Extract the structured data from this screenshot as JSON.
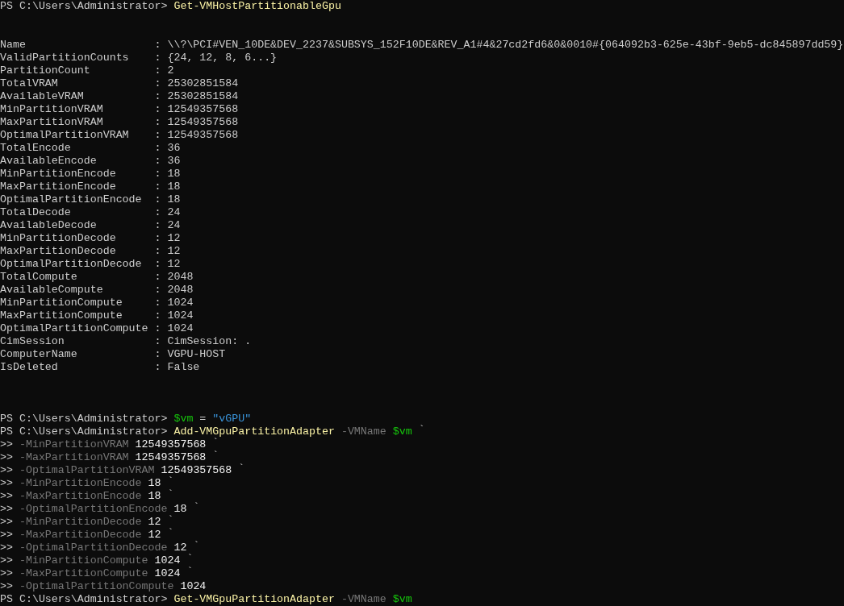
{
  "lines": [
    {
      "kind": "input",
      "segments": [
        {
          "kind": "prompt",
          "text": "PS C:\\Users\\Administrator>"
        },
        {
          "kind": "command",
          "text": "Get-VMHostPartitionableGpu"
        }
      ]
    },
    {
      "kind": "blank"
    },
    {
      "kind": "blank"
    },
    {
      "kind": "property",
      "name": "Name",
      "sep": ":",
      "value": "\\\\?\\PCI#VEN_10DE&DEV_2237&SUBSYS_152F10DE&REV_A1#4&27cd2fd6&0&0010#{064092b3-625e-43bf-9eb5-dc845897dd59}"
    },
    {
      "kind": "property",
      "name": "ValidPartitionCounts",
      "sep": ":",
      "value": "{24, 12, 8, 6...}"
    },
    {
      "kind": "property",
      "name": "PartitionCount",
      "sep": ":",
      "value": "2"
    },
    {
      "kind": "property",
      "name": "TotalVRAM",
      "sep": ":",
      "value": "25302851584"
    },
    {
      "kind": "property",
      "name": "AvailableVRAM",
      "sep": ":",
      "value": "25302851584"
    },
    {
      "kind": "property",
      "name": "MinPartitionVRAM",
      "sep": ":",
      "value": "12549357568"
    },
    {
      "kind": "property",
      "name": "MaxPartitionVRAM",
      "sep": ":",
      "value": "12549357568"
    },
    {
      "kind": "property",
      "name": "OptimalPartitionVRAM",
      "sep": ":",
      "value": "12549357568"
    },
    {
      "kind": "property",
      "name": "TotalEncode",
      "sep": ":",
      "value": "36"
    },
    {
      "kind": "property",
      "name": "AvailableEncode",
      "sep": ":",
      "value": "36"
    },
    {
      "kind": "property",
      "name": "MinPartitionEncode",
      "sep": ":",
      "value": "18"
    },
    {
      "kind": "property",
      "name": "MaxPartitionEncode",
      "sep": ":",
      "value": "18"
    },
    {
      "kind": "property",
      "name": "OptimalPartitionEncode",
      "sep": ":",
      "value": "18"
    },
    {
      "kind": "property",
      "name": "TotalDecode",
      "sep": ":",
      "value": "24"
    },
    {
      "kind": "property",
      "name": "AvailableDecode",
      "sep": ":",
      "value": "24"
    },
    {
      "kind": "property",
      "name": "MinPartitionDecode",
      "sep": ":",
      "value": "12"
    },
    {
      "kind": "property",
      "name": "MaxPartitionDecode",
      "sep": ":",
      "value": "12"
    },
    {
      "kind": "property",
      "name": "OptimalPartitionDecode",
      "sep": ":",
      "value": "12"
    },
    {
      "kind": "property",
      "name": "TotalCompute",
      "sep": ":",
      "value": "2048"
    },
    {
      "kind": "property",
      "name": "AvailableCompute",
      "sep": ":",
      "value": "2048"
    },
    {
      "kind": "property",
      "name": "MinPartitionCompute",
      "sep": ":",
      "value": "1024"
    },
    {
      "kind": "property",
      "name": "MaxPartitionCompute",
      "sep": ":",
      "value": "1024"
    },
    {
      "kind": "property",
      "name": "OptimalPartitionCompute",
      "sep": ":",
      "value": "1024"
    },
    {
      "kind": "property",
      "name": "CimSession",
      "sep": ":",
      "value": "CimSession: ."
    },
    {
      "kind": "property",
      "name": "ComputerName",
      "sep": ":",
      "value": "VGPU-HOST"
    },
    {
      "kind": "property",
      "name": "IsDeleted",
      "sep": ":",
      "value": "False"
    },
    {
      "kind": "blank"
    },
    {
      "kind": "blank"
    },
    {
      "kind": "blank"
    },
    {
      "kind": "input",
      "segments": [
        {
          "kind": "prompt",
          "text": "PS C:\\Users\\Administrator>"
        },
        {
          "kind": "variable",
          "text": "$vm"
        },
        {
          "kind": "operator",
          "text": "="
        },
        {
          "kind": "string",
          "text": "\"vGPU\""
        }
      ]
    },
    {
      "kind": "input",
      "segments": [
        {
          "kind": "prompt",
          "text": "PS C:\\Users\\Administrator>"
        },
        {
          "kind": "command",
          "text": "Add-VMGpuPartitionAdapter"
        },
        {
          "kind": "parameter",
          "text": "-VMName"
        },
        {
          "kind": "variable",
          "text": "$vm"
        },
        {
          "kind": "tick",
          "text": "`"
        }
      ]
    },
    {
      "kind": "input",
      "segments": [
        {
          "kind": "continuation",
          "text": ">>"
        },
        {
          "kind": "parameter",
          "text": "-MinPartitionVRAM"
        },
        {
          "kind": "value",
          "text": "12549357568"
        },
        {
          "kind": "tick",
          "text": "`"
        }
      ]
    },
    {
      "kind": "input",
      "segments": [
        {
          "kind": "continuation",
          "text": ">>"
        },
        {
          "kind": "parameter",
          "text": "-MaxPartitionVRAM"
        },
        {
          "kind": "value",
          "text": "12549357568"
        },
        {
          "kind": "tick",
          "text": "`"
        }
      ]
    },
    {
      "kind": "input",
      "segments": [
        {
          "kind": "continuation",
          "text": ">>"
        },
        {
          "kind": "parameter",
          "text": "-OptimalPartitionVRAM"
        },
        {
          "kind": "value",
          "text": "12549357568"
        },
        {
          "kind": "tick",
          "text": "`"
        }
      ]
    },
    {
      "kind": "input",
      "segments": [
        {
          "kind": "continuation",
          "text": ">>"
        },
        {
          "kind": "parameter",
          "text": "-MinPartitionEncode"
        },
        {
          "kind": "value",
          "text": "18"
        },
        {
          "kind": "tick",
          "text": "`"
        }
      ]
    },
    {
      "kind": "input",
      "segments": [
        {
          "kind": "continuation",
          "text": ">>"
        },
        {
          "kind": "parameter",
          "text": "-MaxPartitionEncode"
        },
        {
          "kind": "value",
          "text": "18"
        },
        {
          "kind": "tick",
          "text": "`"
        }
      ]
    },
    {
      "kind": "input",
      "segments": [
        {
          "kind": "continuation",
          "text": ">>"
        },
        {
          "kind": "parameter",
          "text": "-OptimalPartitionEncode"
        },
        {
          "kind": "value",
          "text": "18"
        },
        {
          "kind": "tick",
          "text": "`"
        }
      ]
    },
    {
      "kind": "input",
      "segments": [
        {
          "kind": "continuation",
          "text": ">>"
        },
        {
          "kind": "parameter",
          "text": "-MinPartitionDecode"
        },
        {
          "kind": "value",
          "text": "12"
        },
        {
          "kind": "tick",
          "text": "`"
        }
      ]
    },
    {
      "kind": "input",
      "segments": [
        {
          "kind": "continuation",
          "text": ">>"
        },
        {
          "kind": "parameter",
          "text": "-MaxPartitionDecode"
        },
        {
          "kind": "value",
          "text": "12"
        },
        {
          "kind": "tick",
          "text": "`"
        }
      ]
    },
    {
      "kind": "input",
      "segments": [
        {
          "kind": "continuation",
          "text": ">>"
        },
        {
          "kind": "parameter",
          "text": "-OptimalPartitionDecode"
        },
        {
          "kind": "value",
          "text": "12"
        },
        {
          "kind": "tick",
          "text": "`"
        }
      ]
    },
    {
      "kind": "input",
      "segments": [
        {
          "kind": "continuation",
          "text": ">>"
        },
        {
          "kind": "parameter",
          "text": "-MinPartitionCompute"
        },
        {
          "kind": "value",
          "text": "1024"
        },
        {
          "kind": "tick",
          "text": "`"
        }
      ]
    },
    {
      "kind": "input",
      "segments": [
        {
          "kind": "continuation",
          "text": ">>"
        },
        {
          "kind": "parameter",
          "text": "-MaxPartitionCompute"
        },
        {
          "kind": "value",
          "text": "1024"
        },
        {
          "kind": "tick",
          "text": "`"
        }
      ]
    },
    {
      "kind": "input",
      "segments": [
        {
          "kind": "continuation",
          "text": ">>"
        },
        {
          "kind": "parameter",
          "text": "-OptimalPartitionCompute"
        },
        {
          "kind": "value",
          "text": "1024"
        }
      ]
    },
    {
      "kind": "input",
      "segments": [
        {
          "kind": "prompt",
          "text": "PS C:\\Users\\Administrator>"
        },
        {
          "kind": "command",
          "text": "Get-VMGpuPartitionAdapter"
        },
        {
          "kind": "parameter",
          "text": "-VMName"
        },
        {
          "kind": "variable",
          "text": "$vm"
        }
      ]
    }
  ]
}
